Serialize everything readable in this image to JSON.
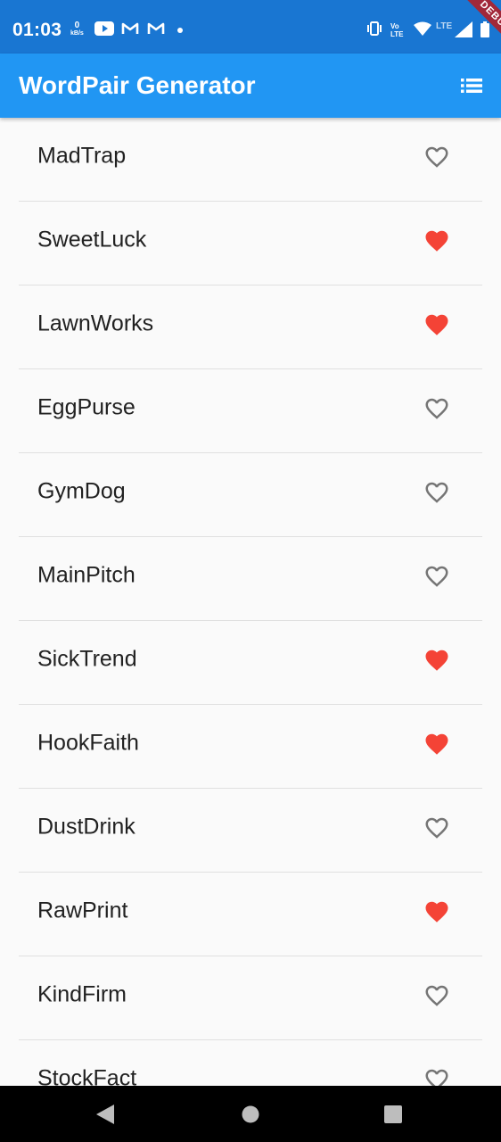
{
  "status_bar": {
    "time": "01:03",
    "speed_value": "0",
    "speed_unit": "kB/s",
    "volte_top": "Vo",
    "volte_bottom": "LTE",
    "network": "LTE",
    "debug_banner": "DEBUG"
  },
  "app_bar": {
    "title": "WordPair Generator",
    "list_icon": "list-icon"
  },
  "words": [
    {
      "label": "MadTrap",
      "saved": false
    },
    {
      "label": "SweetLuck",
      "saved": true
    },
    {
      "label": "LawnWorks",
      "saved": true
    },
    {
      "label": "EggPurse",
      "saved": false
    },
    {
      "label": "GymDog",
      "saved": false
    },
    {
      "label": "MainPitch",
      "saved": false
    },
    {
      "label": "SickTrend",
      "saved": true
    },
    {
      "label": "HookFaith",
      "saved": true
    },
    {
      "label": "DustDrink",
      "saved": false
    },
    {
      "label": "RawPrint",
      "saved": true
    },
    {
      "label": "KindFirm",
      "saved": false
    },
    {
      "label": "StockFact",
      "saved": false
    }
  ],
  "colors": {
    "status_bar": "#1976d2",
    "app_bar": "#2196f3",
    "favorite": "#f44336",
    "outline": "#757575"
  }
}
